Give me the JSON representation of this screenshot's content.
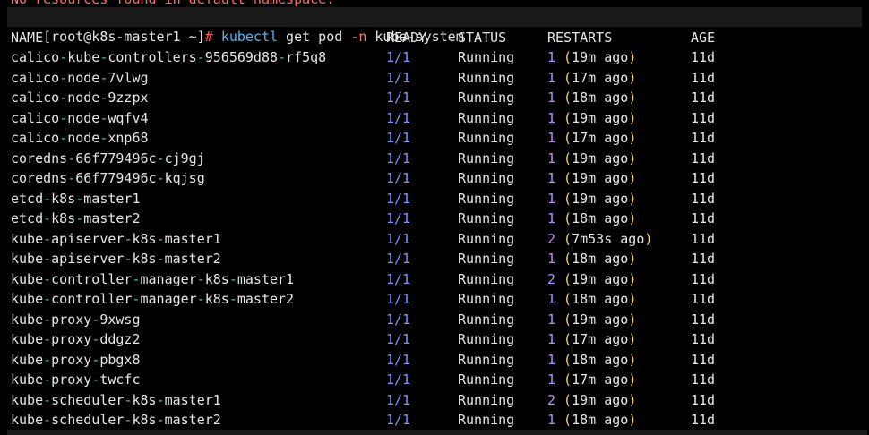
{
  "terminal": {
    "top_cut_text": "No resources found in default namespace.",
    "prompt": {
      "user_host": "[root@k8s-master1 ~]",
      "mark": "#",
      "command": "kubectl",
      "args_pre": " get pod ",
      "flag": "-n",
      "args_post": " kube-system"
    },
    "headers": {
      "name": "NAME",
      "ready": "READY",
      "status": "STATUS",
      "restarts": "RESTARTS",
      "age": "AGE"
    },
    "rows": [
      {
        "name": "calico-kube-controllers-956569d88-rf5q8",
        "ready": "1/1",
        "status": "Running",
        "restarts": "1",
        "ago": "19m ago",
        "age": "11d"
      },
      {
        "name": "calico-node-7vlwg",
        "ready": "1/1",
        "status": "Running",
        "restarts": "1",
        "ago": "17m ago",
        "age": "11d"
      },
      {
        "name": "calico-node-9zzpx",
        "ready": "1/1",
        "status": "Running",
        "restarts": "1",
        "ago": "18m ago",
        "age": "11d"
      },
      {
        "name": "calico-node-wqfv4",
        "ready": "1/1",
        "status": "Running",
        "restarts": "1",
        "ago": "19m ago",
        "age": "11d"
      },
      {
        "name": "calico-node-xnp68",
        "ready": "1/1",
        "status": "Running",
        "restarts": "1",
        "ago": "17m ago",
        "age": "11d"
      },
      {
        "name": "coredns-66f779496c-cj9gj",
        "ready": "1/1",
        "status": "Running",
        "restarts": "1",
        "ago": "19m ago",
        "age": "11d"
      },
      {
        "name": "coredns-66f779496c-kqjsg",
        "ready": "1/1",
        "status": "Running",
        "restarts": "1",
        "ago": "19m ago",
        "age": "11d"
      },
      {
        "name": "etcd-k8s-master1",
        "ready": "1/1",
        "status": "Running",
        "restarts": "1",
        "ago": "19m ago",
        "age": "11d"
      },
      {
        "name": "etcd-k8s-master2",
        "ready": "1/1",
        "status": "Running",
        "restarts": "1",
        "ago": "18m ago",
        "age": "11d"
      },
      {
        "name": "kube-apiserver-k8s-master1",
        "ready": "1/1",
        "status": "Running",
        "restarts": "2",
        "ago": "7m53s ago",
        "age": "11d"
      },
      {
        "name": "kube-apiserver-k8s-master2",
        "ready": "1/1",
        "status": "Running",
        "restarts": "1",
        "ago": "18m ago",
        "age": "11d"
      },
      {
        "name": "kube-controller-manager-k8s-master1",
        "ready": "1/1",
        "status": "Running",
        "restarts": "2",
        "ago": "19m ago",
        "age": "11d"
      },
      {
        "name": "kube-controller-manager-k8s-master2",
        "ready": "1/1",
        "status": "Running",
        "restarts": "1",
        "ago": "18m ago",
        "age": "11d"
      },
      {
        "name": "kube-proxy-9xwsg",
        "ready": "1/1",
        "status": "Running",
        "restarts": "1",
        "ago": "19m ago",
        "age": "11d"
      },
      {
        "name": "kube-proxy-ddgz2",
        "ready": "1/1",
        "status": "Running",
        "restarts": "1",
        "ago": "17m ago",
        "age": "11d"
      },
      {
        "name": "kube-proxy-pbgx8",
        "ready": "1/1",
        "status": "Running",
        "restarts": "1",
        "ago": "18m ago",
        "age": "11d"
      },
      {
        "name": "kube-proxy-twcfc",
        "ready": "1/1",
        "status": "Running",
        "restarts": "1",
        "ago": "17m ago",
        "age": "11d"
      },
      {
        "name": "kube-scheduler-k8s-master1",
        "ready": "1/1",
        "status": "Running",
        "restarts": "2",
        "ago": "19m ago",
        "age": "11d"
      },
      {
        "name": "kube-scheduler-k8s-master2",
        "ready": "1/1",
        "status": "Running",
        "restarts": "1",
        "ago": "18m ago",
        "age": "11d"
      }
    ],
    "colors": {
      "background": "#000000",
      "text": "#e6e6e6",
      "hyphen": "#3fcf8e",
      "ready": "#7b95ff",
      "restart_count": "#b88cff",
      "parens": "#ffd35a",
      "command": "#4fb9ff",
      "flag": "#ff7a7a"
    }
  }
}
